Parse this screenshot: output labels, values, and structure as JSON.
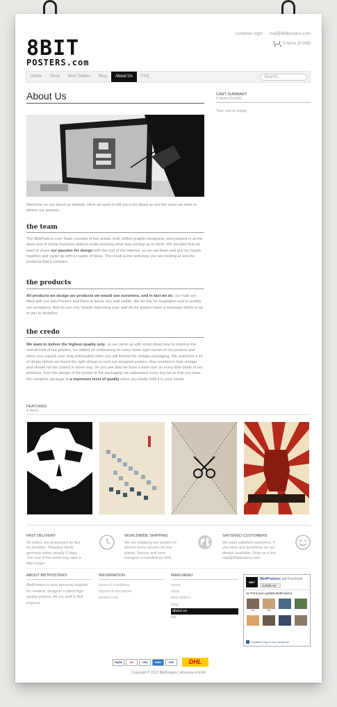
{
  "brand": {
    "line1": "8BIT",
    "line2": "POSTERS.com"
  },
  "top_links": {
    "login": "customer login",
    "email": "mail@8bitposters.com"
  },
  "cart_link": "0 items (0.00€)",
  "nav": {
    "items": [
      {
        "label": "Home"
      },
      {
        "label": "Shop"
      },
      {
        "label": "Best Sellers"
      },
      {
        "label": "Blog"
      },
      {
        "label": "About Us",
        "active": true
      },
      {
        "label": "FAQ"
      }
    ],
    "search_placeholder": "Search..."
  },
  "page_title": "About Us",
  "intro": "Welcome on our about us website. Here we want to tell you a bit about us and the ways we work to deliver our passion.",
  "sections": [
    {
      "heading": "the team",
      "p1": "The 8bitPosters.com Team consists of two artists, both skilled graphic-designers, who jumped in at the deep end of online business without really knowing what was coming up to them. We decided that we want to share ",
      "bold": "our passion for design",
      "p2": " with the rest of the internet, so we sat down and put our heads together and came up with a couple of ideas. The result is the webshop you are looking at and the products that it contains."
    },
    {
      "heading": "the products",
      "bold": "All products we design are products we would use ourselves, and in fact we do",
      "p1": ", our halls are filled with our own Posters and there is barely any wall visible. We do this for inspiration and to prettify our workplace. And so can you, beside improving your wall all our posters have a message which is up to you to decipher."
    },
    {
      "heading": "the credo",
      "bold": "We want to deliver the highest quality only",
      "p1": ", so we came up with some ideas how to improve the overall look of our posters, we added an embossing on every lower right corner of our posters and when you unpack your long anticipated order you will behold the vintage packaging. We searched a lot of shops before we found the right strings to cord our wrapped posters, they needed to look vintage and should not be coated in some way. So you see that we have a keen eye on every little detail of our products, from the design of the poster to the packaging we elaborated every tiny bit so that you have the complete package at ",
      "bold2": "a maximum level of quality",
      "p2": " when you finally hold it in your hands."
    }
  ],
  "sidebar": {
    "title": "CART SUMMARY",
    "subtitle": "0 items (0.00€)",
    "empty": "Your cart is empty."
  },
  "featured": {
    "title": "FEATURED",
    "subtitle": "4 items"
  },
  "features": [
    {
      "title": "FAST DELIVERY",
      "text": "All orders are processed as fast as possible. Shipping inside germany takes usually 3 days. The rest of the world may take a little longer.",
      "icon": "clock-icon"
    },
    {
      "title": "WORLDWIDE SHIPPING",
      "text": "We are shipping our posters to almost every country on this planet. Secure and save transport is handled by DHL.",
      "icon": "globe-icon"
    },
    {
      "title": "SATISFIED CUSTOMERS",
      "text": "We want satisfied customers, if you have any questions we are always available. Drop us a line",
      "link": "mail@8bitposters.com",
      "icon": "smiley-icon"
    }
  ],
  "footer": {
    "about": {
      "title": "ABOUT 8BITPOSTERS",
      "text": "8bitPosters is your personal supplier for creative, designer crafted high quality posters. All our stuff is 8bit inspired."
    },
    "information": {
      "title": "INFORMATION",
      "links": [
        "terms & conditions",
        "imprint & disclaimer",
        "product info"
      ]
    },
    "main_menu": {
      "title": "MAIN MENU",
      "links": [
        "home",
        "shop",
        "best sellers",
        "blog",
        "about us",
        "faq"
      ],
      "active_index": 4
    }
  },
  "facebook": {
    "page_name": "8bitPosters",
    "suffix": "auf Facebook",
    "like": "Gefällt mir",
    "count": "11 Personen gefällt 8bitPosters.",
    "faces": [
      "Jan",
      "Ilka",
      "",
      "",
      "",
      "",
      "",
      ""
    ],
    "social": "Soziales Plug-in von Facebook"
  },
  "payments": [
    "PayPal",
    "MC",
    "VISA",
    "AMEX",
    "MAE"
  ],
  "shipper": "DHL",
  "copyright": "Copyright © 2012 8bitPosters | All prices in EUR"
}
